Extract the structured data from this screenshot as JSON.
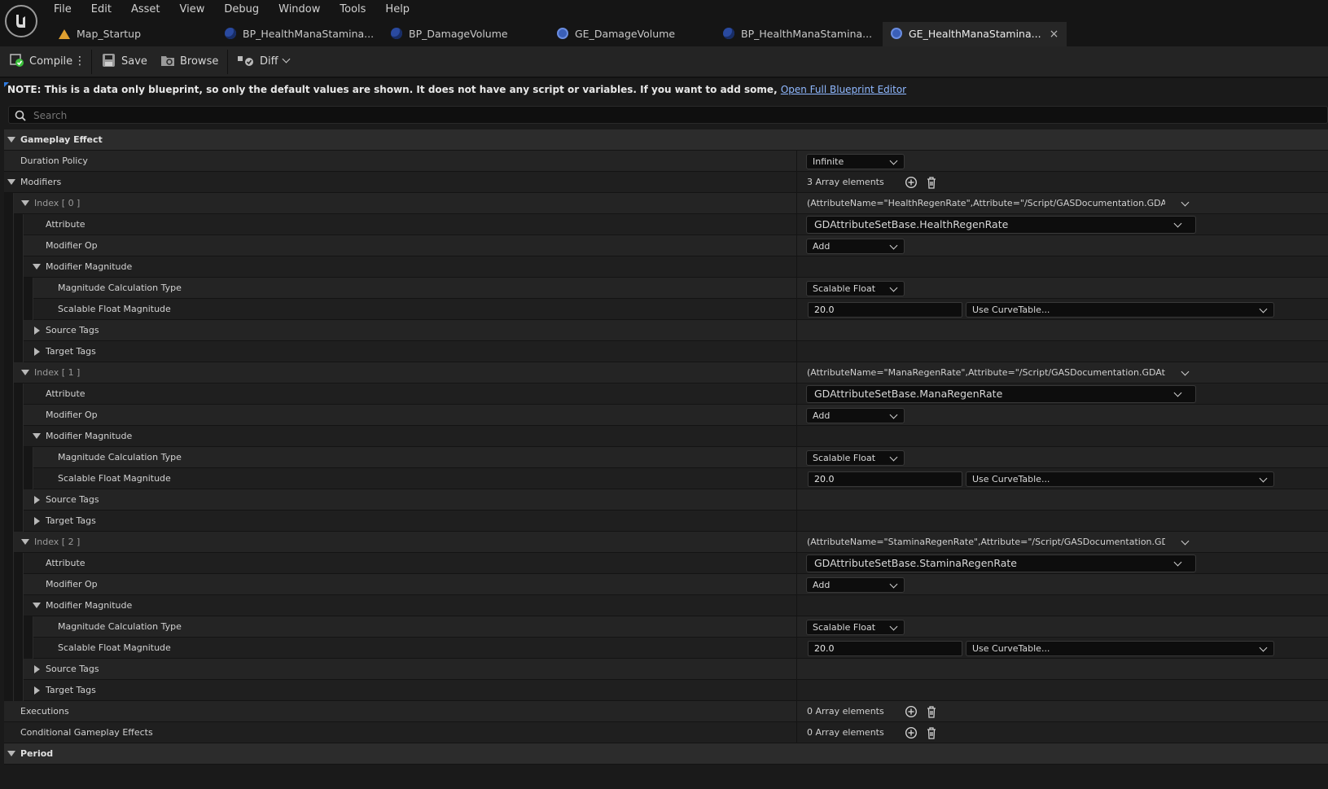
{
  "menu": [
    "File",
    "Edit",
    "Asset",
    "View",
    "Debug",
    "Window",
    "Tools",
    "Help"
  ],
  "tabs": [
    {
      "label": "Map_Startup",
      "icon": "map-icon"
    },
    {
      "label": "BP_HealthManaStamina...",
      "icon": "blueprint-icon"
    },
    {
      "label": "BP_DamageVolume",
      "icon": "blueprint-icon"
    },
    {
      "label": "GE_DamageVolume",
      "icon": "gameplay-effect-icon"
    },
    {
      "label": "BP_HealthManaStamina...",
      "icon": "blueprint-icon"
    },
    {
      "label": "GE_HealthManaStamina...",
      "icon": "gameplay-effect-icon",
      "active": true,
      "close": "×"
    }
  ],
  "toolbar": {
    "compile": "Compile",
    "save": "Save",
    "browse": "Browse",
    "diff": "Diff"
  },
  "note": {
    "text": "NOTE: This is a data only blueprint, so only the default values are shown.  It does not have any script or variables.  If you want to add some, ",
    "link": "Open Full Blueprint Editor"
  },
  "search": {
    "placeholder": "Search"
  },
  "details": {
    "category_gameplay_effect": "Gameplay Effect",
    "duration_policy": {
      "label": "Duration Policy",
      "value": "Infinite"
    },
    "modifiers": {
      "label": "Modifiers",
      "count": "3 Array elements"
    },
    "labels": {
      "attribute": "Attribute",
      "modifier_op": "Modifier Op",
      "modifier_magnitude": "Modifier Magnitude",
      "magnitude_calc_type": "Magnitude Calculation Type",
      "scalable_float_magnitude": "Scalable Float Magnitude",
      "source_tags": "Source Tags",
      "target_tags": "Target Tags"
    },
    "items": [
      {
        "index": "Index [ 0 ]",
        "struct": "(AttributeName=\"HealthRegenRate\",Attribute=\"/Script/GASDocumentation.GDAttributeSetBa",
        "attribute": "GDAttributeSetBase.HealthRegenRate",
        "modifier_op": "Add",
        "calc_type": "Scalable Float",
        "magnitude": "20.0",
        "curve": "Use CurveTable..."
      },
      {
        "index": "Index [ 1 ]",
        "struct": "(AttributeName=\"ManaRegenRate\",Attribute=\"/Script/GASDocumentation.GDAttributeSetBa",
        "attribute": "GDAttributeSetBase.ManaRegenRate",
        "modifier_op": "Add",
        "calc_type": "Scalable Float",
        "magnitude": "20.0",
        "curve": "Use CurveTable..."
      },
      {
        "index": "Index [ 2 ]",
        "struct": "(AttributeName=\"StaminaRegenRate\",Attribute=\"/Script/GASDocumentation.GDAttributeSet",
        "attribute": "GDAttributeSetBase.StaminaRegenRate",
        "modifier_op": "Add",
        "calc_type": "Scalable Float",
        "magnitude": "20.0",
        "curve": "Use CurveTable..."
      }
    ],
    "executions": {
      "label": "Executions",
      "count": "0 Array elements"
    },
    "conditional": {
      "label": "Conditional Gameplay Effects",
      "count": "0 Array elements"
    },
    "category_period": "Period"
  },
  "colors": {
    "accent_link": "#8fb8ff",
    "note_marker": "#2f7be0",
    "compile_ok": "#3cc03c",
    "background": "#1a1a1a"
  }
}
